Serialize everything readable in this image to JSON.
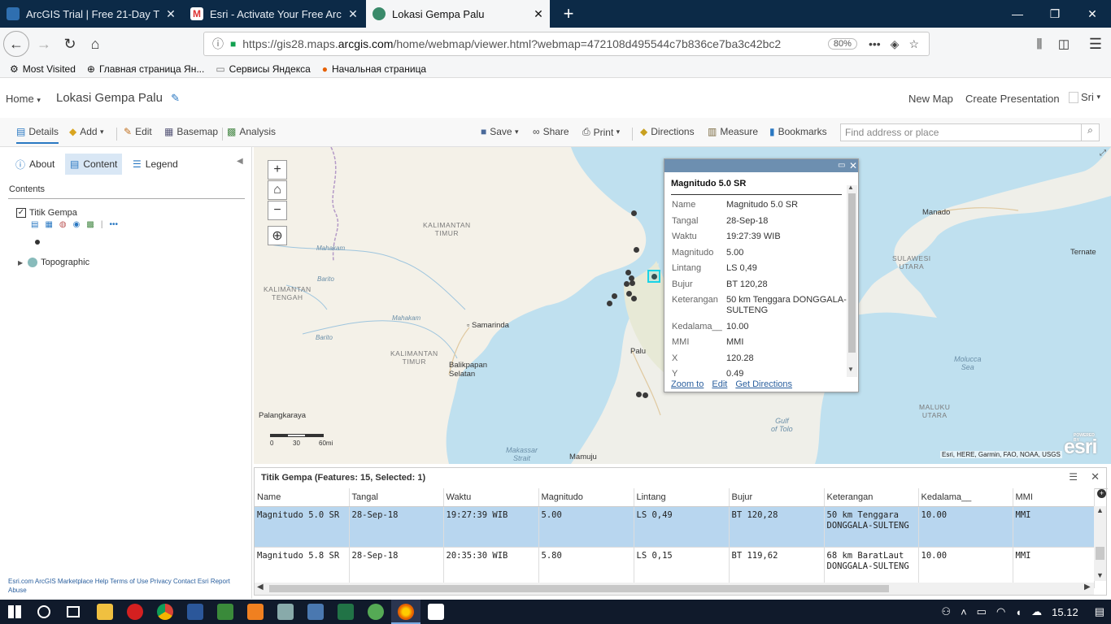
{
  "browser": {
    "tabs": [
      {
        "label": "ArcGIS Trial | Free 21-Day Trial",
        "icon": "arcgis-icon"
      },
      {
        "label": "Esri - Activate Your Free ArcGIS",
        "icon": "gmail-icon"
      },
      {
        "label": "Lokasi Gempa Palu",
        "icon": "globe-icon"
      }
    ],
    "url_prefix": "https://gis28.maps.",
    "url_domain": "arcgis.com",
    "url_rest": "/home/webmap/viewer.html?webmap=472108d495544c7b836ce7ba3c42bc2",
    "zoom": "80%",
    "bookmarks": [
      "Most Visited",
      "Главная страница Ян...",
      "Сервисы Яндекса",
      "Начальная страница"
    ]
  },
  "app": {
    "home": "Home",
    "map_title": "Lokasi Gempa Palu",
    "new_map": "New Map",
    "create_presentation": "Create Presentation",
    "user": "Sri"
  },
  "toolbar": {
    "details": "Details",
    "add": "Add",
    "edit": "Edit",
    "basemap": "Basemap",
    "analysis": "Analysis",
    "save": "Save",
    "share": "Share",
    "print": "Print",
    "directions": "Directions",
    "measure": "Measure",
    "bookmarks": "Bookmarks",
    "search_placeholder": "Find address or place"
  },
  "panel": {
    "tabs": [
      "About",
      "Content",
      "Legend"
    ],
    "contents_heading": "Contents",
    "layers": [
      "Titik Gempa",
      "Topographic"
    ],
    "footer": "Esri.com   ArcGIS Marketplace   Help   Terms of Use   Privacy   Contact Esri   Report Abuse"
  },
  "map": {
    "labels": {
      "kalimantan_timur": "KALIMANTAN\nTIMUR",
      "kalimantan_tengah": "KALIMANTAN\nTENGAH",
      "kalimantan_timur2": "KALIMANTAN\nTIMUR",
      "mahakam1": "Mahakam",
      "mahakam2": "Mahakam",
      "barito1": "Barito",
      "barito2": "Barito",
      "samarinda": "Samarinda",
      "balikpapan": "Balikpapan\nSelatan",
      "palangkaraya": "Palangkaraya",
      "palu": "Palu",
      "manado": "Manado",
      "sulawesi_utara": "SULAWESI\nUTARA",
      "ternate": "Ternate",
      "molucca_sea": "Molucca\nSea",
      "maluku_utara": "MALUKU\nUTARA",
      "gulf_tolo": "Gulf\nof Tolo",
      "makassar_strait": "Makassar\nStrait",
      "mamuju": "Mamuju"
    },
    "scale": [
      "0",
      "30",
      "60mi"
    ],
    "attribution": "Esri, HERE, Garmin, FAO, NOAA, USGS",
    "esri_logo": "esri",
    "esri_powered": "POWERED BY"
  },
  "popup": {
    "title": "Magnitudo 5.0 SR",
    "fields": [
      {
        "k": "Name",
        "v": "Magnitudo 5.0 SR"
      },
      {
        "k": "Tangal",
        "v": "28-Sep-18"
      },
      {
        "k": "Waktu",
        "v": "19:27:39 WIB"
      },
      {
        "k": "Magnitudo",
        "v": "5.00"
      },
      {
        "k": "Lintang",
        "v": "LS 0,49"
      },
      {
        "k": "Bujur",
        "v": "BT 120,28"
      },
      {
        "k": "Keterangan",
        "v": "50 km Tenggara DONGGALA-SULTENG"
      },
      {
        "k": "Kedalama__",
        "v": "10.00"
      },
      {
        "k": "MMI",
        "v": "MMI"
      },
      {
        "k": "X",
        "v": "120.28"
      },
      {
        "k": "Y",
        "v": "0.49"
      }
    ],
    "zoom_to": "Zoom to",
    "edit": "Edit",
    "get_directions": "Get Directions"
  },
  "table": {
    "title": "Titik Gempa (Features: 15, Selected: 1)",
    "columns": [
      "Name",
      "Tangal",
      "Waktu",
      "Magnitudo",
      "Lintang",
      "Bujur",
      "Keterangan",
      "Kedalama__",
      "MMI"
    ],
    "rows": [
      [
        "Magnitudo 5.0 SR",
        "28-Sep-18",
        "19:27:39 WIB",
        "5.00",
        "LS 0,49",
        "BT 120,28",
        "50 km Tenggara DONGGALA-SULTENG",
        "10.00",
        "MMI"
      ],
      [
        "Magnitudo 5.8 SR",
        "28-Sep-18",
        "20:35:30 WIB",
        "5.80",
        "LS 0,15",
        "BT 119,62",
        "68 km BaratLaut DONGGALA-SULTENG",
        "10.00",
        "MMI"
      ]
    ]
  },
  "taskbar": {
    "time": "15.12"
  }
}
